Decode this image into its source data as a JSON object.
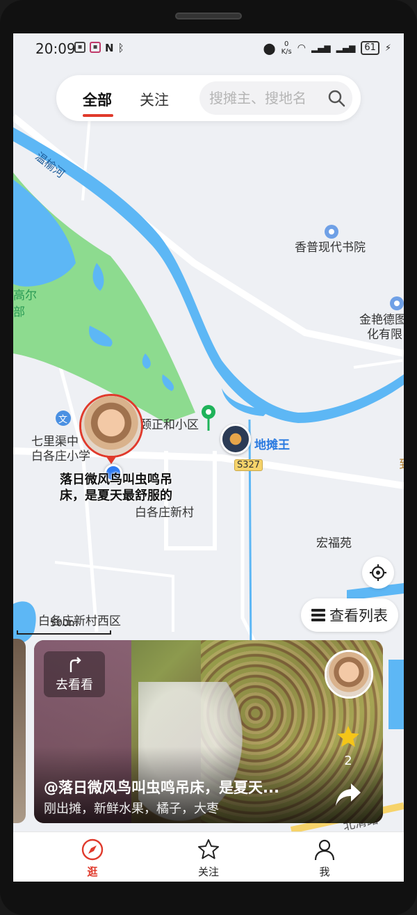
{
  "status": {
    "time": "20:09",
    "net_speed_value": "0",
    "net_speed_unit": "K/s",
    "battery": "61",
    "left_icons": [
      "hd-icon",
      "nfc-icon",
      "bluetooth-icon"
    ]
  },
  "tabs": [
    {
      "label": "全部",
      "active": true
    },
    {
      "label": "关注",
      "active": false
    }
  ],
  "search": {
    "placeholder": "搜摊主、搜地名"
  },
  "map": {
    "labels": {
      "river": "温榆河",
      "academy": "香普现代书院",
      "jinyan_1": "金艳德图",
      "jinyan_2": "化有限",
      "golf_1": "高尔",
      "golf_2": "部",
      "community": "颐正和小区",
      "school_1": "七里渠中",
      "school_2": "白各庄小学",
      "road": "S327",
      "village": "白各庄新村",
      "hongfu": "宏福苑",
      "village_west": "白各庄新村西区",
      "vendor": "地摊王",
      "edge": "到",
      "road_bottom": "北清路",
      "school_badge": "文"
    },
    "scale": "500m"
  },
  "pin": {
    "caption": "落日微风鸟叫虫鸣吊床，是夏天最舒服的"
  },
  "buttons": {
    "list": "查看列表"
  },
  "card": {
    "goto": "去看看",
    "stars": "2",
    "title": "@落日微风鸟叫虫鸣吊床，是夏天...",
    "subtitle": "刚出摊，新鲜水果，橘子，大枣"
  },
  "nav": [
    {
      "label": "逛",
      "icon": "compass-icon",
      "active": true
    },
    {
      "label": "关注",
      "icon": "star-icon",
      "active": false
    },
    {
      "label": "我",
      "icon": "person-icon",
      "active": false
    }
  ],
  "colors": {
    "accent": "#e03a2c",
    "water": "#5db7f5",
    "park": "#8ddb8f",
    "pin_blue": "#2f7bf2"
  }
}
